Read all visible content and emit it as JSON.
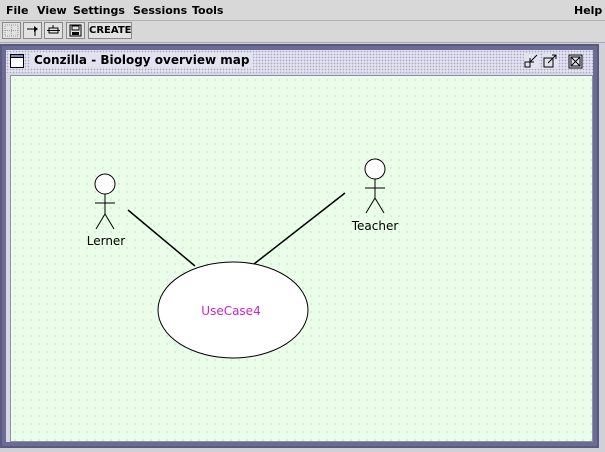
{
  "menu": {
    "file": "File",
    "view": "View",
    "settings": "Settings",
    "sessions": "Sessions",
    "tools": "Tools",
    "help": "Help"
  },
  "toolbar": {
    "tools": [
      {
        "icon": "select-grid-icon"
      },
      {
        "icon": "pointer-tool-icon"
      },
      {
        "icon": "link-tool-icon"
      },
      {
        "icon": "save-icon"
      }
    ],
    "create_label": "CREATE"
  },
  "window": {
    "title": "Conzilla - Biology overview map",
    "controls": [
      "minimize-icon",
      "maximize-icon",
      "close-icon"
    ]
  },
  "map": {
    "actors": [
      {
        "label": "Lerner"
      },
      {
        "label": "Teacher"
      }
    ],
    "usecase": {
      "label": "UseCase4",
      "color": "#cc22cc"
    },
    "canvas_color": "#e9fde9",
    "dot_color": "#9fc49f"
  }
}
